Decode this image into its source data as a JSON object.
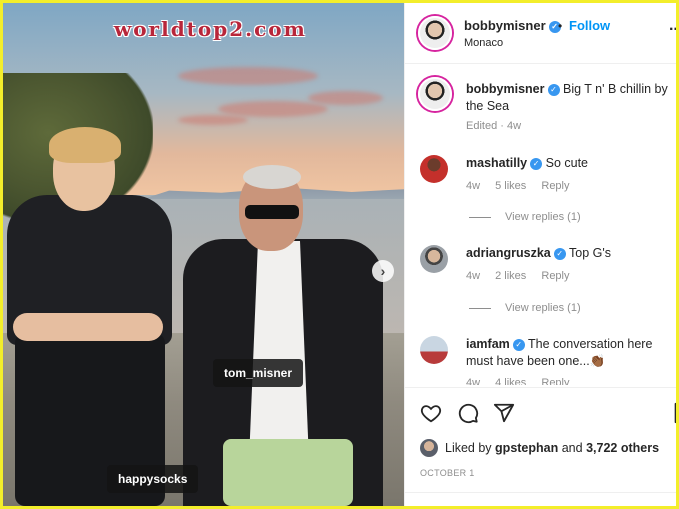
{
  "watermark": "worldtop2.com",
  "photo": {
    "tags": {
      "tom": "tom_misner",
      "happy": "happysocks"
    },
    "next_icon": "chevron-right-icon"
  },
  "header": {
    "username": "bobbymisner",
    "dot": "•",
    "follow_label": "Follow",
    "location": "Monaco",
    "more": "···"
  },
  "caption": {
    "username": "bobbymisner",
    "text": "Big T n' B chillin by the Sea",
    "meta": "Edited · 4w"
  },
  "comments": [
    {
      "username": "mashatilly",
      "text": "So cute",
      "age": "4w",
      "likes": "5 likes",
      "reply": "Reply",
      "replies": "View replies (1)"
    },
    {
      "username": "adriangruszka",
      "text": "Top G's",
      "age": "4w",
      "likes": "2 likes",
      "reply": "Reply",
      "replies": "View replies (1)"
    },
    {
      "username": "iamfam",
      "text": "The conversation here must have been one...👏🏾",
      "age": "4w",
      "likes": "4 likes",
      "reply": "Reply"
    }
  ],
  "likes": {
    "liked_by": "Liked by",
    "user": "gpstephan",
    "and": "and",
    "count": "3,722 others"
  },
  "date": "OCTOBER 1",
  "colors": {
    "accent": "#0095f6",
    "verified": "#3897f0",
    "frame": "#f3ee2b"
  }
}
